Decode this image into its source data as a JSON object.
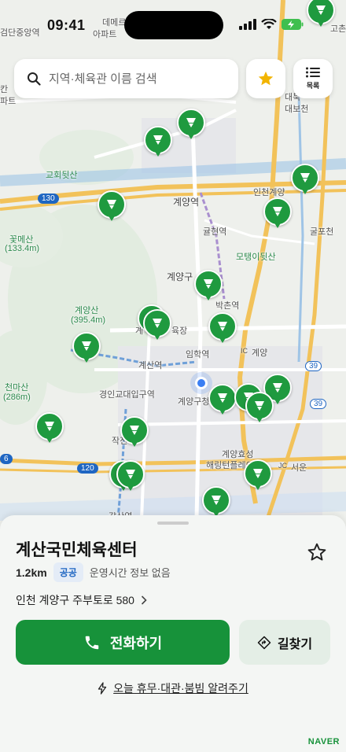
{
  "status_bar": {
    "time": "09:41"
  },
  "search": {
    "placeholder": "지역·체육관 이름 검색"
  },
  "list_button": {
    "label": "목록"
  },
  "map": {
    "labels": [
      "검단중앙역",
      "데메르디앙",
      "아파트",
      "칸",
      "파트",
      "대북",
      "대보천",
      "고촌",
      "교회뒷산",
      "인천계양",
      "계양역",
      "귤현역",
      "굴포천",
      "꽃메산",
      "(133.4m)",
      "모탱이뒷산",
      "계양구",
      "박촌역",
      "계양산",
      "(395.4m)",
      "육장",
      "계",
      "임학역",
      "계산역",
      "IC",
      "계양",
      "천마산",
      "(286m)",
      "경인교대입구역",
      "계양구청",
      "작전",
      "계양효성",
      "해링턴플레이스",
      "JC",
      "서운",
      "갈산역"
    ],
    "road_numbers": [
      "130",
      "39",
      "39",
      "120",
      "6"
    ]
  },
  "facility": {
    "name": "계산국민체육센터",
    "distance": "1.2km",
    "badge": "공공",
    "hours": "운영시간 정보 없음",
    "address": "인천 계양구 주부토로 580"
  },
  "actions": {
    "call": "전화하기",
    "directions": "길찾기",
    "notify": "오늘 휴무·대관·붐빔 알려주기"
  },
  "footer": {
    "brand": "NAVER"
  },
  "colors": {
    "accent": "#17923a",
    "pin": "#1f9a3f",
    "badge_text": "#1f66c2"
  },
  "icons": [
    "search-icon",
    "star-icon",
    "list-icon",
    "phone-icon",
    "directions-icon",
    "bolt-icon",
    "chevron-right-icon",
    "gym-marker-icon"
  ]
}
